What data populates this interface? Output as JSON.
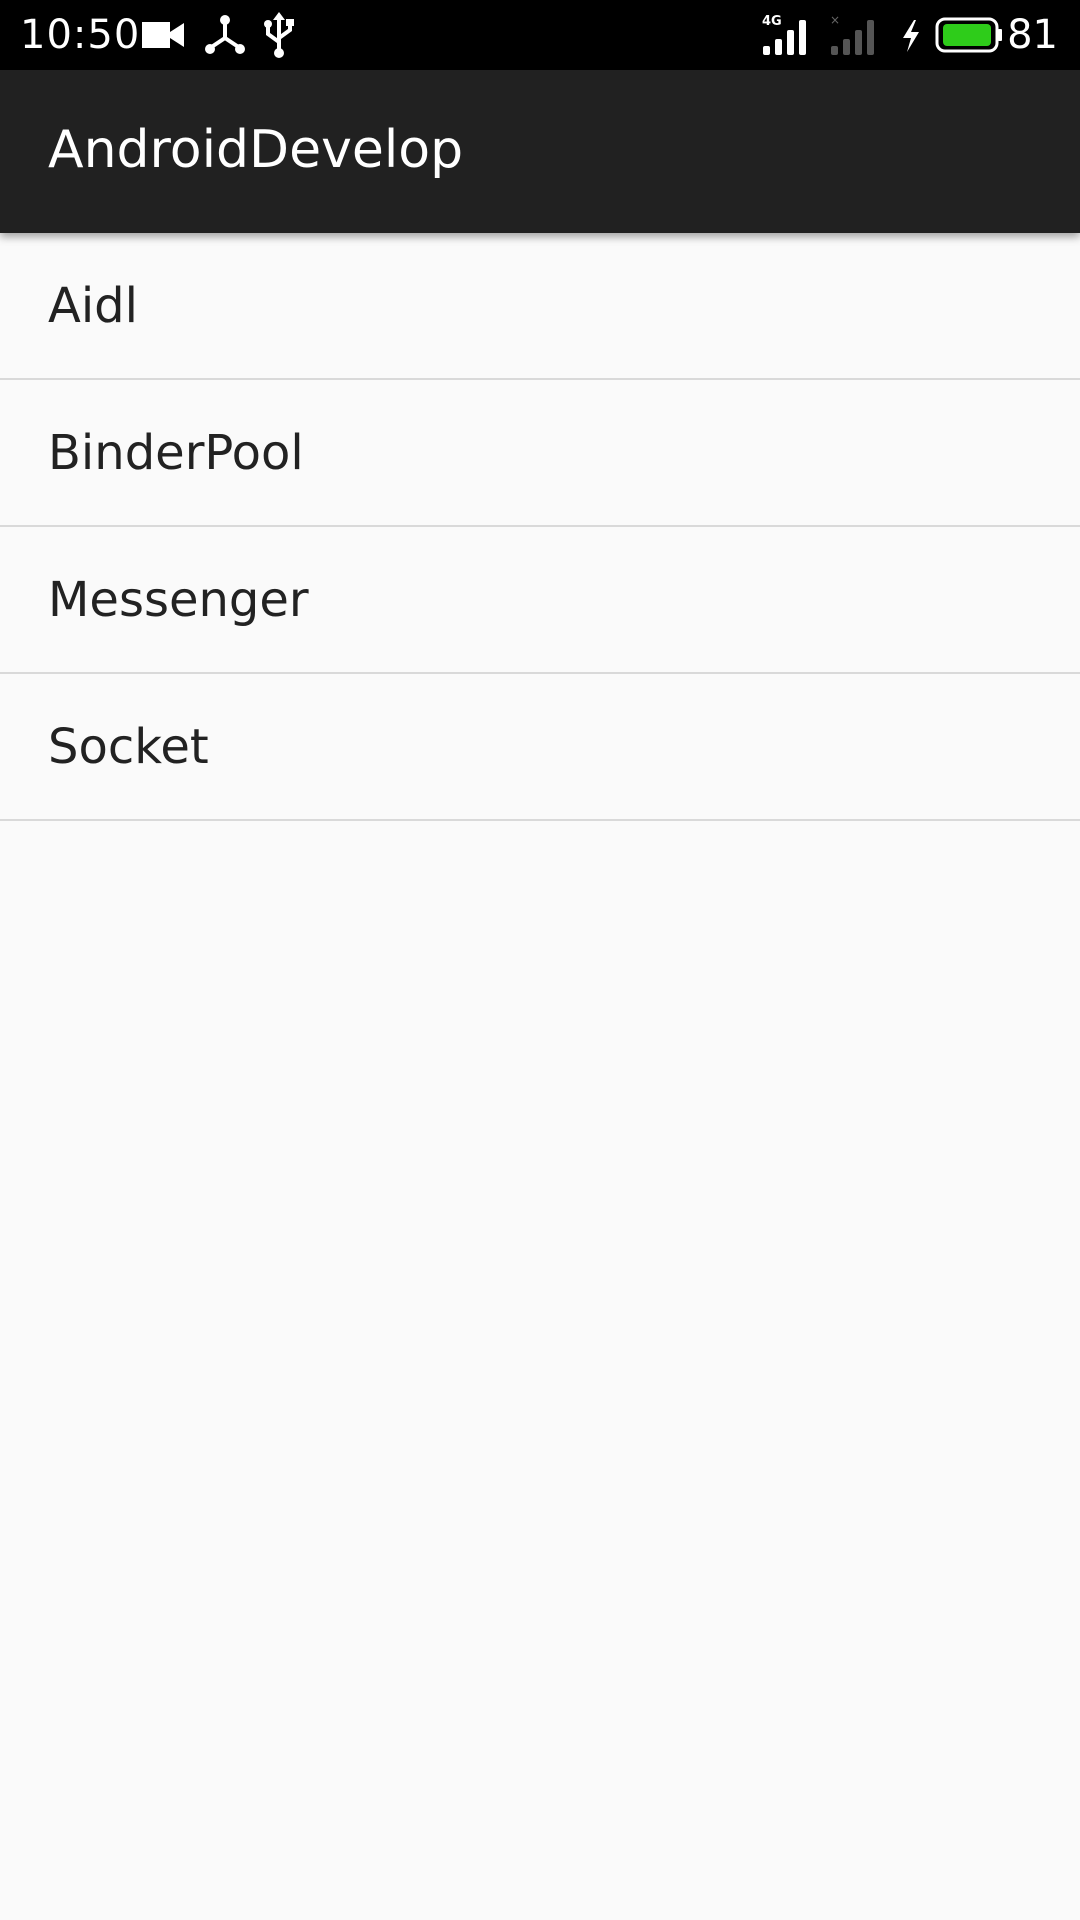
{
  "status_bar": {
    "time": "10:50",
    "network_type": "4G",
    "battery_percent": "81",
    "icons": [
      "video-camera-icon",
      "share-network-icon",
      "usb-icon",
      "signal-4g-icon",
      "signal-no-service-icon",
      "charging-bolt-icon",
      "battery-icon"
    ],
    "battery_color": "#2ecc1a"
  },
  "app_bar": {
    "title": "AndroidDevelop",
    "background": "#212121"
  },
  "list": {
    "items": [
      {
        "label": "Aidl"
      },
      {
        "label": "BinderPool"
      },
      {
        "label": "Messenger"
      },
      {
        "label": "Socket"
      }
    ]
  }
}
